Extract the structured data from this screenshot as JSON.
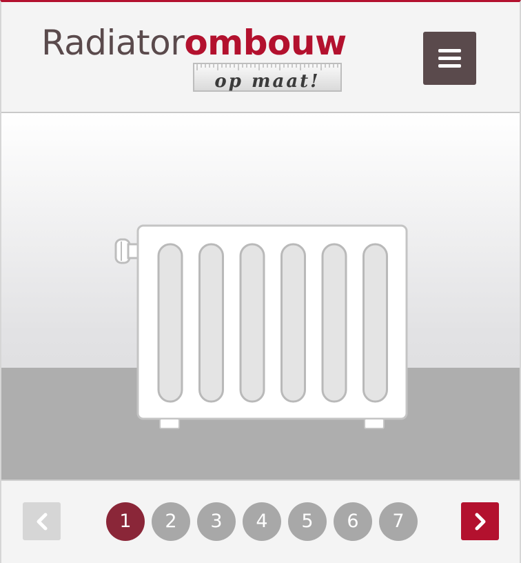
{
  "logo": {
    "word_part1": "Radiator",
    "word_part2": "ombouw",
    "tagline": "op maat!"
  },
  "header": {
    "menu_icon": "hamburger-icon"
  },
  "slider": {
    "image": "radiator-illustration",
    "current_page": 1,
    "pages": [
      "1",
      "2",
      "3",
      "4",
      "5",
      "6",
      "7"
    ],
    "prev_icon": "chevron-left-icon",
    "next_icon": "chevron-right-icon"
  },
  "colors": {
    "brand_red": "#b3112e",
    "brand_brown": "#5a4a4c",
    "active_dot": "#8a2638",
    "inactive_dot": "#a8a8a8",
    "floor": "#aeaeae"
  }
}
